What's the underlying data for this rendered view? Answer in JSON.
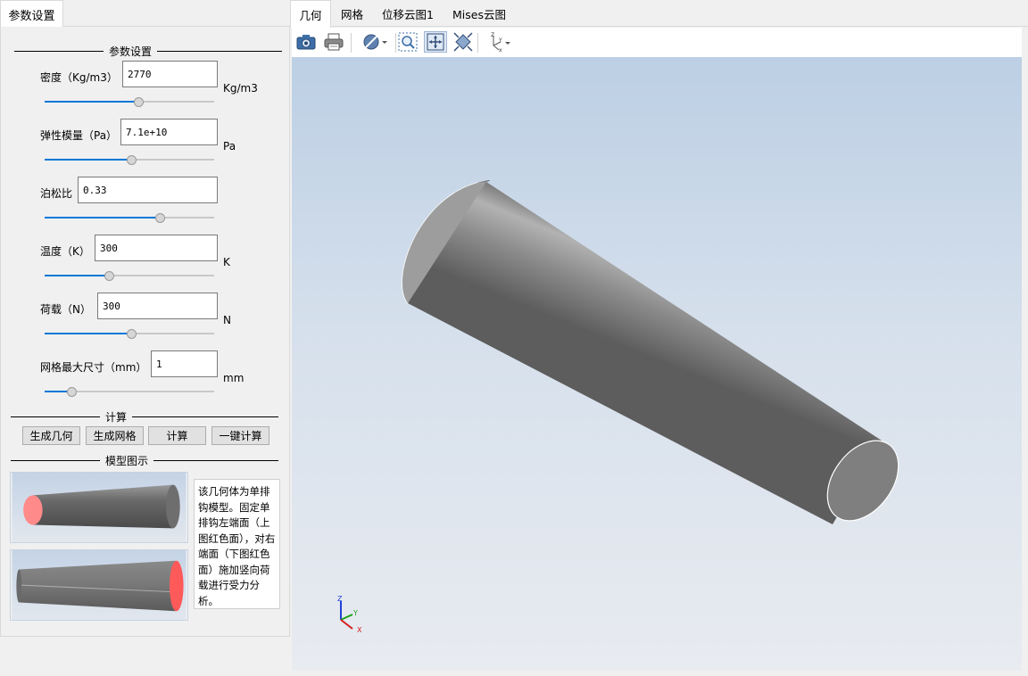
{
  "left_tab": "参数设置",
  "param_group_title": "参数设置",
  "params": [
    {
      "label": "密度（Kg/m3）",
      "value": "2770",
      "unit": "Kg/m3",
      "slider": 0.55
    },
    {
      "label": "弹性模量（Pa）",
      "value": "7.1e+10",
      "unit": "Pa",
      "slider": 0.51
    },
    {
      "label": "泊松比",
      "value": "0.33",
      "unit": "",
      "slider": 0.68
    },
    {
      "label": "温度（K）",
      "value": "300",
      "unit": "K",
      "slider": 0.38
    },
    {
      "label": "荷载（N）",
      "value": "300",
      "unit": "N",
      "slider": 0.51
    },
    {
      "label": "网格最大尺寸（mm）",
      "value": "1",
      "unit": "mm",
      "slider": 0.16
    }
  ],
  "compute_group_title": "计算",
  "buttons": [
    "生成几何",
    "生成网格",
    "计算",
    "一键计算"
  ],
  "model_group_title": "模型图示",
  "description": "该几何体为单排钩模型。固定单排钩左端面（上图红色面），对右端面（下图红色面）施加竖向荷载进行受力分析。",
  "right_tabs": [
    "几何",
    "网格",
    "位移云图1",
    "Mises云图"
  ],
  "active_right_tab": 0,
  "toolbar_icons": [
    "camera-icon",
    "print-icon",
    "display-mode-icon",
    "zoom-box-icon",
    "fit-view-icon",
    "pan-icon",
    "axes-orientation-icon"
  ],
  "axes": {
    "x": "X",
    "y": "Y",
    "z": "Z"
  },
  "colors": {
    "highlight_face": "#ff5a5a",
    "slider_fill": "#0078d7",
    "cylinder": "#9a9a9a"
  }
}
